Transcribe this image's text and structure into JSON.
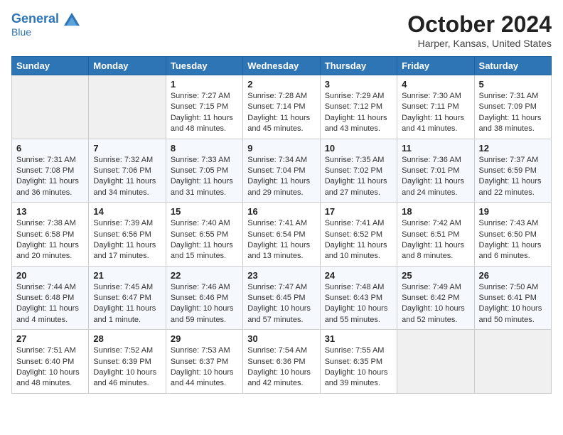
{
  "header": {
    "logo_line1": "General",
    "logo_line2": "Blue",
    "main_title": "October 2024",
    "subtitle": "Harper, Kansas, United States"
  },
  "weekdays": [
    "Sunday",
    "Monday",
    "Tuesday",
    "Wednesday",
    "Thursday",
    "Friday",
    "Saturday"
  ],
  "weeks": [
    [
      {
        "day": "",
        "info": ""
      },
      {
        "day": "",
        "info": ""
      },
      {
        "day": "1",
        "info": "Sunrise: 7:27 AM\nSunset: 7:15 PM\nDaylight: 11 hours and 48 minutes."
      },
      {
        "day": "2",
        "info": "Sunrise: 7:28 AM\nSunset: 7:14 PM\nDaylight: 11 hours and 45 minutes."
      },
      {
        "day": "3",
        "info": "Sunrise: 7:29 AM\nSunset: 7:12 PM\nDaylight: 11 hours and 43 minutes."
      },
      {
        "day": "4",
        "info": "Sunrise: 7:30 AM\nSunset: 7:11 PM\nDaylight: 11 hours and 41 minutes."
      },
      {
        "day": "5",
        "info": "Sunrise: 7:31 AM\nSunset: 7:09 PM\nDaylight: 11 hours and 38 minutes."
      }
    ],
    [
      {
        "day": "6",
        "info": "Sunrise: 7:31 AM\nSunset: 7:08 PM\nDaylight: 11 hours and 36 minutes."
      },
      {
        "day": "7",
        "info": "Sunrise: 7:32 AM\nSunset: 7:06 PM\nDaylight: 11 hours and 34 minutes."
      },
      {
        "day": "8",
        "info": "Sunrise: 7:33 AM\nSunset: 7:05 PM\nDaylight: 11 hours and 31 minutes."
      },
      {
        "day": "9",
        "info": "Sunrise: 7:34 AM\nSunset: 7:04 PM\nDaylight: 11 hours and 29 minutes."
      },
      {
        "day": "10",
        "info": "Sunrise: 7:35 AM\nSunset: 7:02 PM\nDaylight: 11 hours and 27 minutes."
      },
      {
        "day": "11",
        "info": "Sunrise: 7:36 AM\nSunset: 7:01 PM\nDaylight: 11 hours and 24 minutes."
      },
      {
        "day": "12",
        "info": "Sunrise: 7:37 AM\nSunset: 6:59 PM\nDaylight: 11 hours and 22 minutes."
      }
    ],
    [
      {
        "day": "13",
        "info": "Sunrise: 7:38 AM\nSunset: 6:58 PM\nDaylight: 11 hours and 20 minutes."
      },
      {
        "day": "14",
        "info": "Sunrise: 7:39 AM\nSunset: 6:56 PM\nDaylight: 11 hours and 17 minutes."
      },
      {
        "day": "15",
        "info": "Sunrise: 7:40 AM\nSunset: 6:55 PM\nDaylight: 11 hours and 15 minutes."
      },
      {
        "day": "16",
        "info": "Sunrise: 7:41 AM\nSunset: 6:54 PM\nDaylight: 11 hours and 13 minutes."
      },
      {
        "day": "17",
        "info": "Sunrise: 7:41 AM\nSunset: 6:52 PM\nDaylight: 11 hours and 10 minutes."
      },
      {
        "day": "18",
        "info": "Sunrise: 7:42 AM\nSunset: 6:51 PM\nDaylight: 11 hours and 8 minutes."
      },
      {
        "day": "19",
        "info": "Sunrise: 7:43 AM\nSunset: 6:50 PM\nDaylight: 11 hours and 6 minutes."
      }
    ],
    [
      {
        "day": "20",
        "info": "Sunrise: 7:44 AM\nSunset: 6:48 PM\nDaylight: 11 hours and 4 minutes."
      },
      {
        "day": "21",
        "info": "Sunrise: 7:45 AM\nSunset: 6:47 PM\nDaylight: 11 hours and 1 minute."
      },
      {
        "day": "22",
        "info": "Sunrise: 7:46 AM\nSunset: 6:46 PM\nDaylight: 10 hours and 59 minutes."
      },
      {
        "day": "23",
        "info": "Sunrise: 7:47 AM\nSunset: 6:45 PM\nDaylight: 10 hours and 57 minutes."
      },
      {
        "day": "24",
        "info": "Sunrise: 7:48 AM\nSunset: 6:43 PM\nDaylight: 10 hours and 55 minutes."
      },
      {
        "day": "25",
        "info": "Sunrise: 7:49 AM\nSunset: 6:42 PM\nDaylight: 10 hours and 52 minutes."
      },
      {
        "day": "26",
        "info": "Sunrise: 7:50 AM\nSunset: 6:41 PM\nDaylight: 10 hours and 50 minutes."
      }
    ],
    [
      {
        "day": "27",
        "info": "Sunrise: 7:51 AM\nSunset: 6:40 PM\nDaylight: 10 hours and 48 minutes."
      },
      {
        "day": "28",
        "info": "Sunrise: 7:52 AM\nSunset: 6:39 PM\nDaylight: 10 hours and 46 minutes."
      },
      {
        "day": "29",
        "info": "Sunrise: 7:53 AM\nSunset: 6:37 PM\nDaylight: 10 hours and 44 minutes."
      },
      {
        "day": "30",
        "info": "Sunrise: 7:54 AM\nSunset: 6:36 PM\nDaylight: 10 hours and 42 minutes."
      },
      {
        "day": "31",
        "info": "Sunrise: 7:55 AM\nSunset: 6:35 PM\nDaylight: 10 hours and 39 minutes."
      },
      {
        "day": "",
        "info": ""
      },
      {
        "day": "",
        "info": ""
      }
    ]
  ]
}
